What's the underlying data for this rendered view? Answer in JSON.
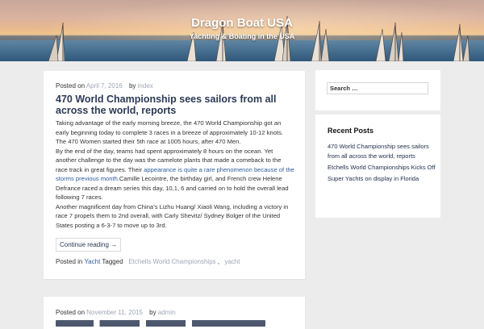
{
  "header": {
    "site_title": "Dragon Boat USA",
    "tagline": "Yachting & Boating in the USA"
  },
  "post1": {
    "posted_on_label": "Posted on",
    "date": "April 7, 2016",
    "by_label": "by",
    "author": "index",
    "title": "470 World Championship sees sailors from all across the world, reports",
    "para1": "Taking advantage of the early morning breeze, the 470 World Championship got an early beginning today to complete 3 races in a breeze of approximately 10-12 knots. The 470 Women started their 5th race at 1005 hours, after 470 Men.",
    "para2_before": "By the end of the day, teams had spent approximately 8 hours on the ocean. Yet another challenge to the day was the camelote plants that made a comeback to the race track in great figures. Their ",
    "para2_link": "appearance is quite a rare phenomenon because of the storms previous month",
    "para2_after": ".Camille Lecointre, the birthday girl, and French crew Helene Defrance raced a dream series this day, 10,1, 6 and carried on to hold the overall lead following 7 races.",
    "para3": "Another magnificent day from China’s Lizhu Huang/ Xiaoli Wang, including a victory in race 7 propels them to 2nd overall, with Carly Shevitz/ Sydney Bolger of the United States posting a 6-3-7 to move up to 3rd.",
    "continue_label": "Continue reading →",
    "posted_in_label": "Posted in",
    "category": "Yacht",
    "tagged_label": "Tagged",
    "tags": [
      "Etchells World Championships",
      "yacht"
    ],
    "tag_separator": ","
  },
  "post2": {
    "posted_on_label": "Posted on",
    "date": "November 11, 2015",
    "by_label": "by",
    "author": "admin"
  },
  "sidebar": {
    "search_placeholder": "Search …",
    "recent_title": "Recent Posts",
    "recent_posts": [
      "470 World Championship sees sailors from all across the world, reports",
      "Etchells World Championships Kicks Off",
      "Super Yachts on display in Florida"
    ]
  },
  "colors": {
    "background": "#ececec",
    "title": "#2b3a55",
    "link": "#2d5d9c",
    "meta_muted": "#9fa7b5"
  }
}
